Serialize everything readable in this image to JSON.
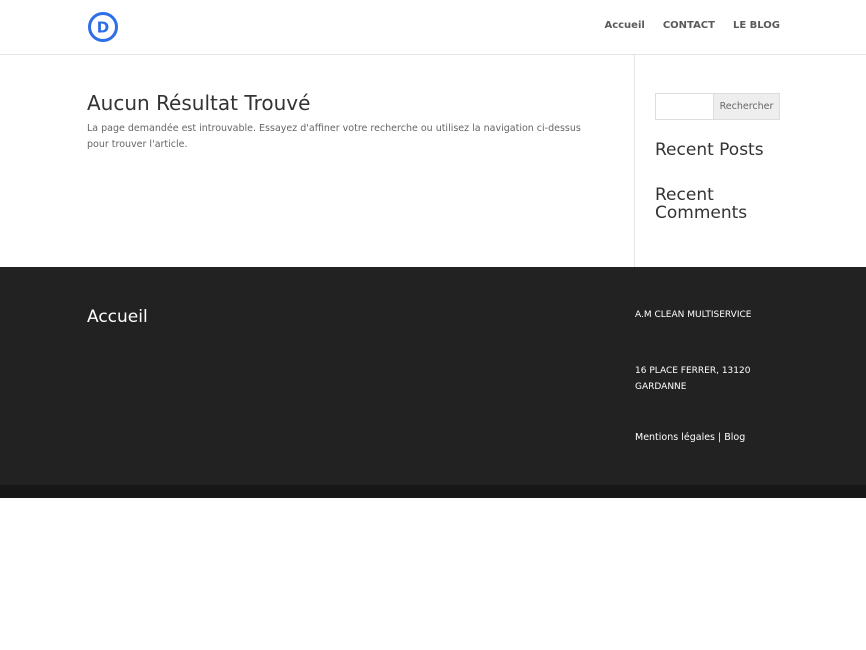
{
  "header": {
    "logo_letter": "D",
    "nav": [
      {
        "label": "Accueil"
      },
      {
        "label": "CONTACT"
      },
      {
        "label": "LE BLOG"
      }
    ],
    "accent_color": "#2e6ee6"
  },
  "main": {
    "title": "Aucun Résultat Trouvé",
    "text": "La page demandée est introuvable. Essayez d'affiner votre recherche ou utilisez la navigation ci-dessus pour trouver l'article."
  },
  "sidebar": {
    "search_value": "",
    "search_button": "Rechercher",
    "recent_posts": "Recent Posts",
    "recent_comments": "Recent Comments"
  },
  "footer": {
    "title": "Accueil",
    "company": "A.M CLEAN MULTISERVICE",
    "address": "16 PLACE FERRER, 13120 GARDANNE",
    "link_mentions": "Mentions légales",
    "separator": "|",
    "link_blog": "Blog"
  }
}
